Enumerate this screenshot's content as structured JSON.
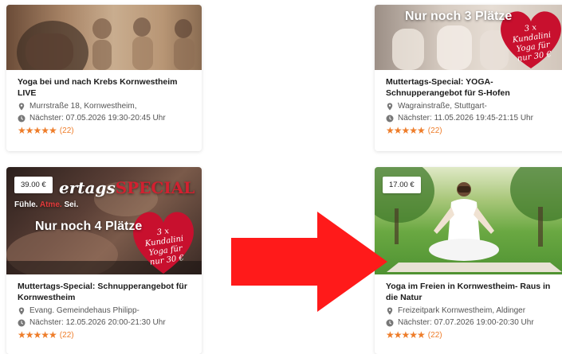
{
  "cards": [
    {
      "title": "Yoga bei und nach Krebs Kornwestheim LIVE",
      "address": "Murrstraße 18, Kornwestheim,",
      "next_date": "Nächster: 07.05.2026 19:30-20:45 Uhr",
      "rating_count": "(22)"
    },
    {
      "title": "Muttertags-Special: YOGA-Schnupperangebot für S-Hofen",
      "address": "Wagrainstraße, Stuttgart-",
      "next_date": "Nächster: 11.05.2026 19:45-21:15 Uhr",
      "rating_count": "(22)",
      "overlay_places": "Nur noch 3 Plätze",
      "heart_text": [
        "3 x Kundalini",
        "Yoga für",
        "nur 30 €"
      ]
    },
    {
      "title": "Muttertags-Special: Schnupperangebot für Kornwestheim",
      "address": "Evang. Gemeindehaus Philipp-",
      "next_date": "Nächster: 12.05.2026 20:00-21:30 Uhr",
      "rating_count": "(22)",
      "price": "39.00 €",
      "banner_left": "ertags",
      "banner_right": "SPECIAL",
      "banner_sub": [
        "Fühle.",
        "Atme.",
        "Sei."
      ],
      "overlay_places": "Nur noch 4 Plätze",
      "heart_text": [
        "3 x Kundalini",
        "Yoga für",
        "nur 30 €"
      ]
    },
    {
      "title": "Yoga im Freien in Kornwestheim- Raus in die Natur",
      "address": "Freizeitpark Kornwestheim, Aldinger",
      "next_date": "Nächster: 07.07.2026 19:00-20:30 Uhr",
      "rating_count": "(22)",
      "price": "17.00 €"
    }
  ],
  "colors": {
    "star": "#ee7d2a",
    "arrow": "#ff1a1a",
    "heart": "#c8102e"
  },
  "icons": {
    "location": "map-pin-icon",
    "clock": "clock-icon",
    "rating": "star-icon"
  }
}
